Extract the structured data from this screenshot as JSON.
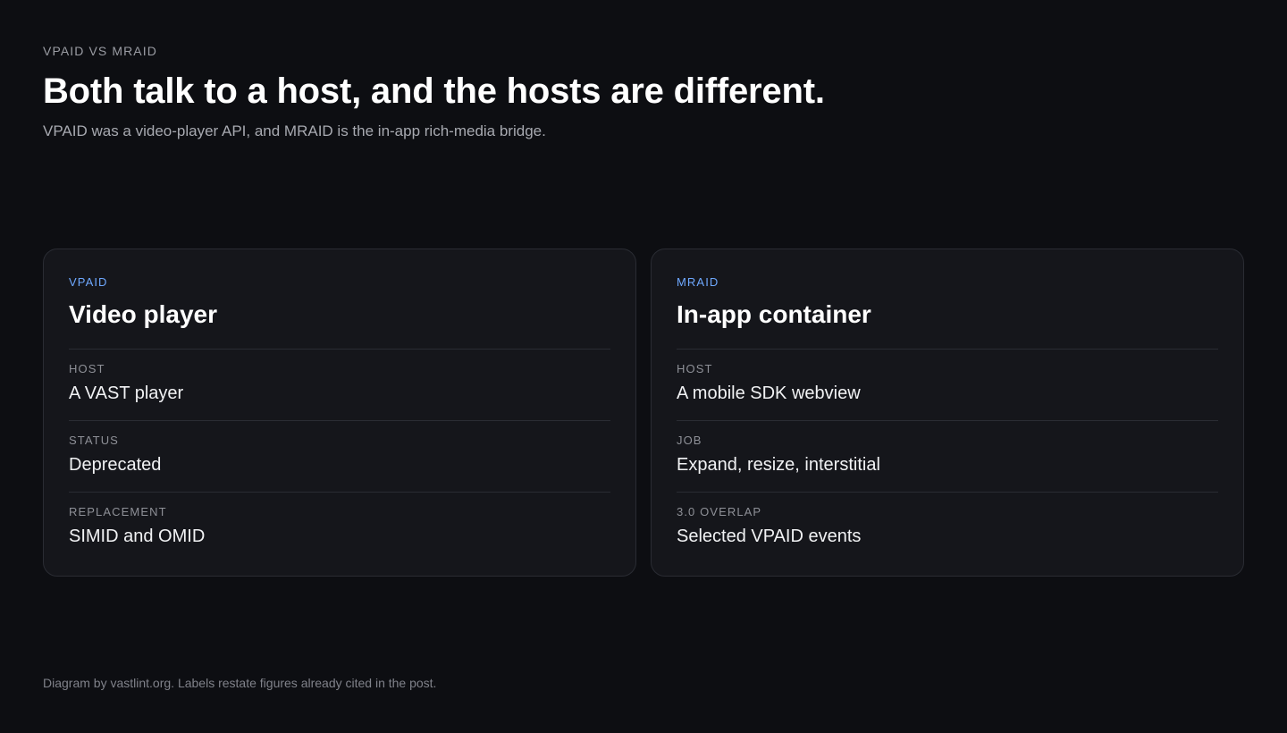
{
  "header": {
    "eyebrow": "VPAID VS MRAID",
    "title": "Both talk to a host, and the hosts are different.",
    "subtitle": "VPAID was a video-player API, and MRAID is the in-app rich-media bridge."
  },
  "cards": [
    {
      "tag": "VPAID",
      "title": "Video player",
      "rows": [
        {
          "label": "HOST",
          "value": "A VAST player"
        },
        {
          "label": "STATUS",
          "value": "Deprecated"
        },
        {
          "label": "REPLACEMENT",
          "value": "SIMID and OMID"
        }
      ]
    },
    {
      "tag": "MRAID",
      "title": "In-app container",
      "rows": [
        {
          "label": "HOST",
          "value": "A mobile SDK webview"
        },
        {
          "label": "JOB",
          "value": "Expand, resize, interstitial"
        },
        {
          "label": "3.0 OVERLAP",
          "value": "Selected VPAID events"
        }
      ]
    }
  ],
  "footer": {
    "note": "Diagram by vastlint.org. Labels restate figures already cited in the post."
  },
  "colors": {
    "background": "#0d0e12",
    "card": "#15161b",
    "accent": "#6ea8ff",
    "border": "#2a2c33"
  }
}
